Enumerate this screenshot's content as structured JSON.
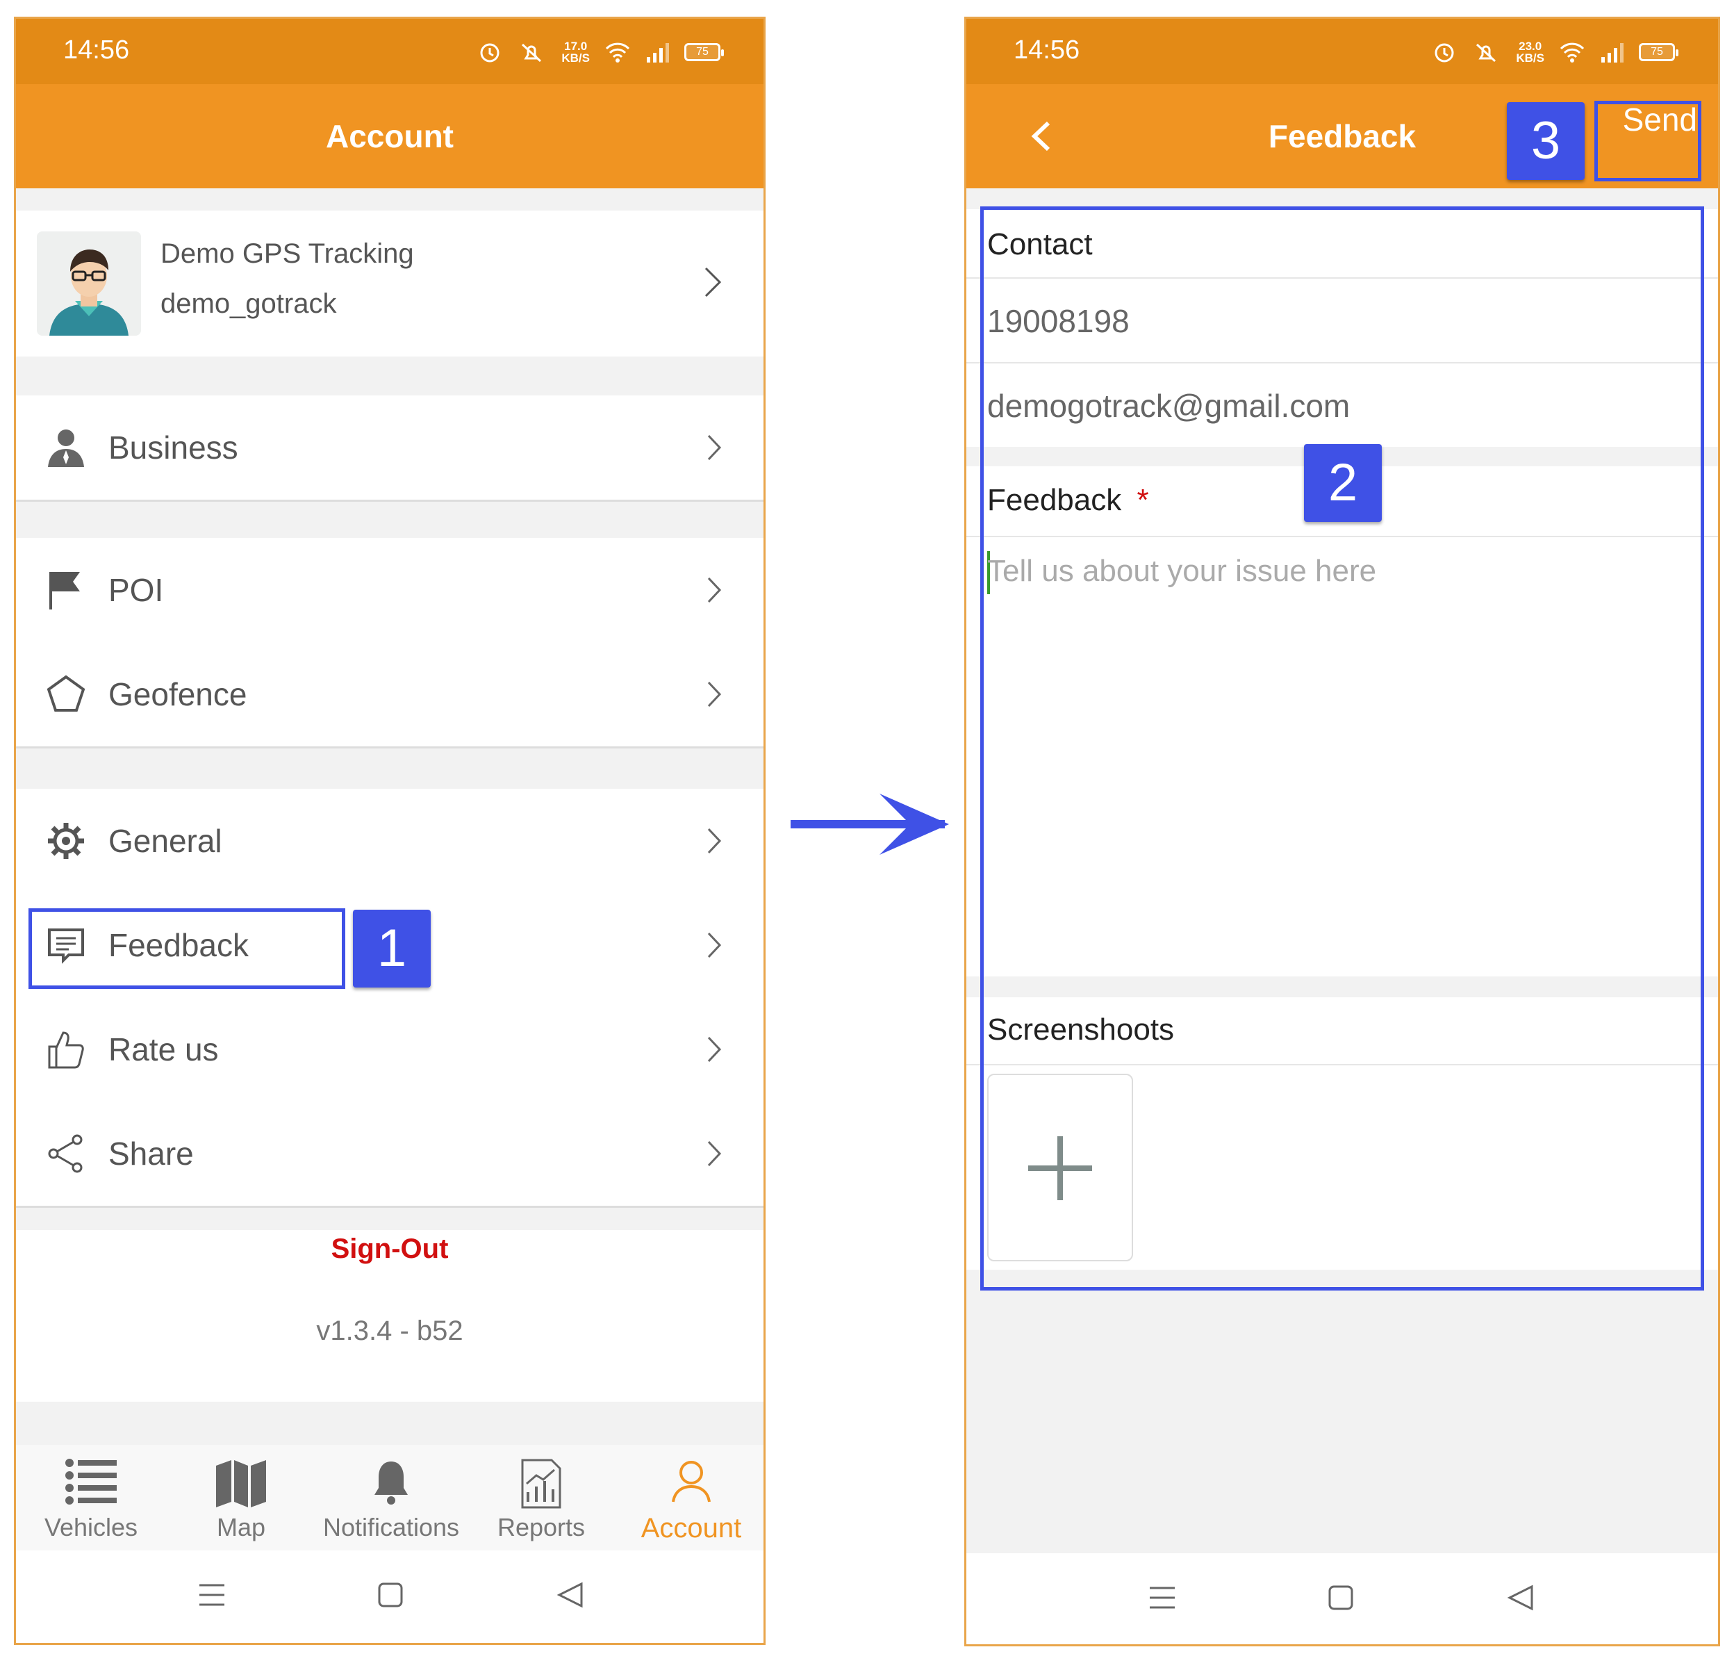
{
  "left_screen": {
    "status_bar": {
      "time": "14:56",
      "speed_value": "17.0",
      "speed_unit": "KB/S",
      "battery": "75"
    },
    "app_bar_title": "Account",
    "profile": {
      "name": "Demo GPS Tracking",
      "username": "demo_gotrack"
    },
    "menu_items": [
      {
        "label": "Business",
        "icon": "person-icon"
      },
      {
        "label": "POI",
        "icon": "flag-icon"
      },
      {
        "label": "Geofence",
        "icon": "pentagon-icon"
      },
      {
        "label": "General",
        "icon": "gear-icon"
      },
      {
        "label": "Feedback",
        "icon": "feedback-icon"
      },
      {
        "label": "Rate us",
        "icon": "thumbs-up-icon"
      },
      {
        "label": "Share",
        "icon": "share-icon"
      }
    ],
    "sign_out": "Sign-Out",
    "version": "v1.3.4 - b52",
    "tabs": [
      {
        "label": "Vehicles",
        "icon": "list-icon"
      },
      {
        "label": "Map",
        "icon": "map-icon"
      },
      {
        "label": "Notifications",
        "icon": "bell-icon"
      },
      {
        "label": "Reports",
        "icon": "reports-icon"
      },
      {
        "label": "Account",
        "icon": "account-icon",
        "active": true
      }
    ]
  },
  "right_screen": {
    "status_bar": {
      "time": "14:56",
      "speed_value": "23.0",
      "speed_unit": "KB/S",
      "battery": "75"
    },
    "app_bar_title": "Feedback",
    "send_label": "Send",
    "contact_label": "Contact",
    "phone": "19008198",
    "email": "demogotrack@gmail.com",
    "feedback_label": "Feedback",
    "required_mark": "*",
    "feedback_placeholder": "Tell us about your issue here",
    "screenshots_label": "Screenshoots"
  },
  "annotations": {
    "step1": "1",
    "step2": "2",
    "step3": "3"
  },
  "colors": {
    "status_bar": "#e38a16",
    "app_bar": "#f09422",
    "annotation": "#3f51e6",
    "sign_out": "#d11010"
  }
}
